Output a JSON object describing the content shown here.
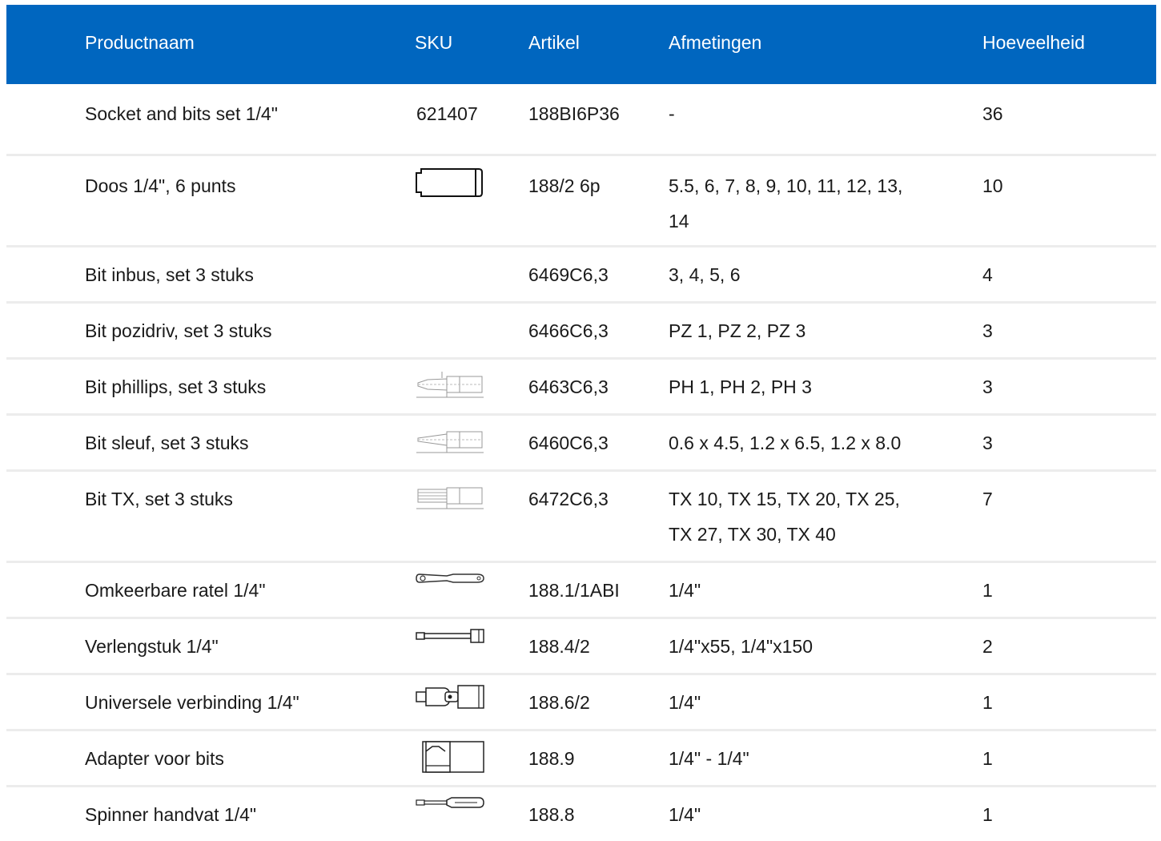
{
  "table": {
    "headers": {
      "name": "Productnaam",
      "sku": "SKU",
      "article": "Artikel",
      "dimensions": "Afmetingen",
      "quantity": "Hoeveelheid"
    },
    "rows": [
      {
        "name": "Socket and bits set 1/4\"",
        "sku": "621407",
        "article": "188BI6P36",
        "dim1": "-",
        "dim2": "",
        "qty": "36",
        "icon": "none"
      },
      {
        "name": "Doos 1/4\", 6 punts",
        "sku": "",
        "article": "188/2 6p",
        "dim1": "5.5, 6, 7, 8, 9, 10, 11, 12, 13,",
        "dim2": "14",
        "qty": "10",
        "icon": "socket-icon"
      },
      {
        "name": "Bit inbus, set 3 stuks",
        "sku": "",
        "article": "6469C6,3",
        "dim1": "3, 4, 5, 6",
        "dim2": "",
        "qty": "4",
        "icon": "none"
      },
      {
        "name": "Bit pozidriv, set 3 stuks",
        "sku": "",
        "article": "6466C6,3",
        "dim1": "PZ 1, PZ 2, PZ 3",
        "dim2": "",
        "qty": "3",
        "icon": "none"
      },
      {
        "name": "Bit phillips, set 3 stuks",
        "sku": "",
        "article": "6463C6,3",
        "dim1": "PH 1, PH 2, PH 3",
        "dim2": "",
        "qty": "3",
        "icon": "phillips-bit-icon"
      },
      {
        "name": "Bit sleuf, set 3 stuks",
        "sku": "",
        "article": "6460C6,3",
        "dim1": "0.6 x 4.5, 1.2 x 6.5, 1.2 x 8.0",
        "dim2": "",
        "qty": "3",
        "icon": "slotted-bit-icon"
      },
      {
        "name": "Bit TX, set 3 stuks",
        "sku": "",
        "article": "6472C6,3",
        "dim1": "TX 10, TX 15, TX 20, TX 25,",
        "dim2": "TX 27, TX 30, TX 40",
        "qty": "7",
        "icon": "torx-bit-icon"
      },
      {
        "name": "Omkeerbare ratel 1/4\"",
        "sku": "",
        "article": "188.1/1ABI",
        "dim1": "1/4\"",
        "dim2": "",
        "qty": "1",
        "icon": "ratchet-icon"
      },
      {
        "name": "Verlengstuk 1/4\"",
        "sku": "",
        "article": "188.4/2",
        "dim1": "1/4\"x55, 1/4\"x150",
        "dim2": "",
        "qty": "2",
        "icon": "extension-bar-icon"
      },
      {
        "name": "Universele verbinding 1/4\"",
        "sku": "",
        "article": "188.6/2",
        "dim1": "1/4\"",
        "dim2": "",
        "qty": "1",
        "icon": "universal-joint-icon"
      },
      {
        "name": "Adapter voor bits",
        "sku": "",
        "article": "188.9",
        "dim1": "1/4\" - 1/4\"",
        "dim2": "",
        "qty": "1",
        "icon": "bit-adapter-icon"
      },
      {
        "name": "Spinner handvat 1/4\"",
        "sku": "",
        "article": "188.8",
        "dim1": "1/4\"",
        "dim2": "",
        "qty": "1",
        "icon": "spinner-handle-icon"
      }
    ]
  }
}
